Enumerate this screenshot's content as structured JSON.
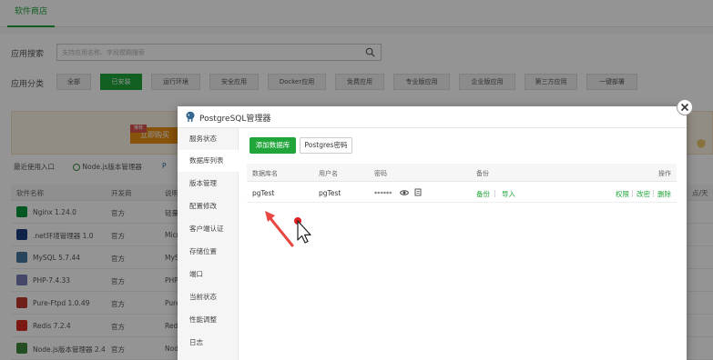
{
  "top_tab": "软件商店",
  "search": {
    "label": "应用搜索",
    "placeholder": "支持应用名称、字段模糊搜索"
  },
  "categories": {
    "label": "应用分类",
    "items": [
      "全部",
      "已安装",
      "运行环境",
      "安全应用",
      "Docker应用",
      "免费应用",
      "专业版应用",
      "企业版应用",
      "第三方应用",
      "一键部署"
    ],
    "active_index": 1
  },
  "banner": {
    "button": "立即购买",
    "tag": "推荐"
  },
  "recent": {
    "label": "最近使用入口",
    "items": [
      "Node.js版本管理器",
      "P"
    ]
  },
  "table": {
    "headers": [
      "软件名称",
      "开发商",
      "说明",
      "点/天"
    ],
    "rows": [
      {
        "name": "Nginx 1.24.0",
        "dev": "官方",
        "desc": "轻量"
      },
      {
        "name": ".net环境管理器 1.0",
        "dev": "官方",
        "desc": "Micr"
      },
      {
        "name": "MySQL 5.7.44",
        "dev": "官方",
        "desc": "MyS"
      },
      {
        "name": "PHP-7.4.33",
        "dev": "官方",
        "desc": "PHP"
      },
      {
        "name": "Pure-Ftpd 1.0.49",
        "dev": "官方",
        "desc": "Pure"
      },
      {
        "name": "Redis 7.2.4",
        "dev": "官方",
        "desc": "Redi"
      },
      {
        "name": "Node.js版本管理器 2.4",
        "dev": "官方",
        "desc": "Nod"
      }
    ]
  },
  "modal": {
    "title": "PostgreSQL管理器",
    "sidebar": [
      "服务状态",
      "数据库列表",
      "版本管理",
      "配置修改",
      "客户端认证",
      "存储位置",
      "端口",
      "当前状态",
      "性能调整",
      "日志"
    ],
    "active_index": 1,
    "add_button": "添加数据库",
    "pg_password_button": "Postgres密码",
    "columns": {
      "db_name": "数据库名",
      "user": "用户名",
      "password": "密码",
      "backup": "备份",
      "ops": "操作"
    },
    "rows": [
      {
        "db_name": "pgTest",
        "user": "pgTest",
        "password": "******",
        "backup": "备份",
        "import": "导入",
        "perm": "权限",
        "change": "改密",
        "delete": "删除"
      }
    ]
  },
  "colors": {
    "accent": "#20a53a",
    "overlay": "#000000",
    "annotation_arrow": "#e8463f"
  }
}
